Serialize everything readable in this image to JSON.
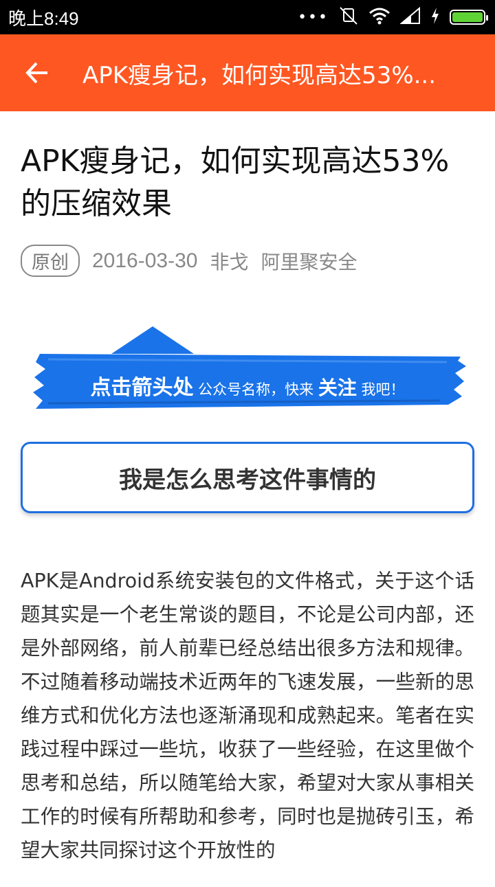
{
  "status_bar": {
    "time": "晚上8:49",
    "icons": [
      "more-dots-icon",
      "silent-icon",
      "wifi-icon",
      "signal-icon",
      "charging-icon",
      "battery-icon"
    ],
    "battery_color": "#5fd336"
  },
  "toolbar": {
    "title": "APK瘦身记，如何实现高达53%...",
    "background": "#ff5722",
    "back_icon": "arrow-left-icon"
  },
  "article": {
    "title": "APK瘦身记，如何实现高达53%的压缩效果",
    "badge": "原创",
    "date": "2016-03-30",
    "author": "非戈",
    "account": "阿里聚安全",
    "banner": {
      "part1": "点击箭头处",
      "part2": "公众号名称，快来",
      "part3": "关注",
      "part4": "我吧！",
      "color": "#1a73e8"
    },
    "section_heading": "我是怎么思考这件事情的",
    "body": "APK是Android系统安装包的文件格式，关于这个话题其实是一个老生常谈的题目，不论是公司内部，还是外部网络，前人前辈已经总结出很多方法和规律。不过随着移动端技术近两年的飞速发展，一些新的思维方式和优化方法也逐渐涌现和成熟起来。笔者在实践过程中踩过一些坑，收获了一些经验，在这里做个思考和总结，所以随笔给大家，希望对大家从事相关工作的时候有所帮助和参考，同时也是抛砖引玉，希望大家共同探讨这个开放性的"
  }
}
